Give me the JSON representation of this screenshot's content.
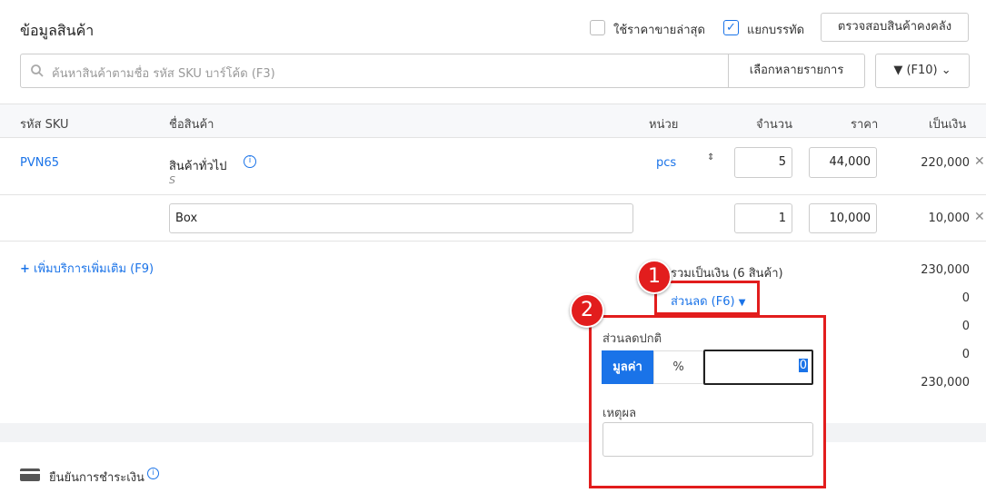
{
  "header": {
    "title": "ข้อมูลสินค้า",
    "checkbox_latest_price": "ใช้ราคาขายล่าสุด",
    "checkbox_split_lines": "แยกบรรทัด",
    "check_stock_button": "ตรวจสอบสินค้าคงคลัง"
  },
  "search": {
    "placeholder": "ค้นหาสินค้าตามชื่อ รหัส SKU บาร์โค้ด (F3)",
    "multi_select_button": "เลือกหลายรายการ",
    "filter_button": "(F10)"
  },
  "table": {
    "headers": {
      "sku": "รหัส SKU",
      "name": "ชื่อสินค้า",
      "unit": "หน่วย",
      "qty": "จำนวน",
      "price": "ราคา",
      "amount": "เป็นเงิน"
    },
    "rows": [
      {
        "sku": "PVN65",
        "name": "สินค้าทั่วไป",
        "sub": "S",
        "unit": "pcs",
        "qty": "5",
        "price": "44,000",
        "amount": "220,000"
      },
      {
        "name": "Box",
        "qty": "1",
        "price": "10,000",
        "amount": "10,000"
      }
    ]
  },
  "add_service": "เพิ่มบริการเพิ่มเติม (F9)",
  "summary": {
    "total_label": "รวมเป็นเงิน (6 สินค้า)",
    "total_value": "230,000",
    "discount_label": "ส่วนลด (F6)",
    "discount_value": "0",
    "row3_value": "0",
    "row4_value": "0",
    "grand_value": "230,000"
  },
  "popup": {
    "title": "ส่วนลดปกติ",
    "tab_value": "มูลค่า",
    "tab_percent": "%",
    "input_value": "0",
    "reason_label": "เหตุผล"
  },
  "payment": {
    "label": "ยืนยันการชำระเงิน"
  },
  "badges": {
    "one": "1",
    "two": "2"
  },
  "colors": {
    "accent": "#1a73e8",
    "highlight": "#e21d1d"
  }
}
